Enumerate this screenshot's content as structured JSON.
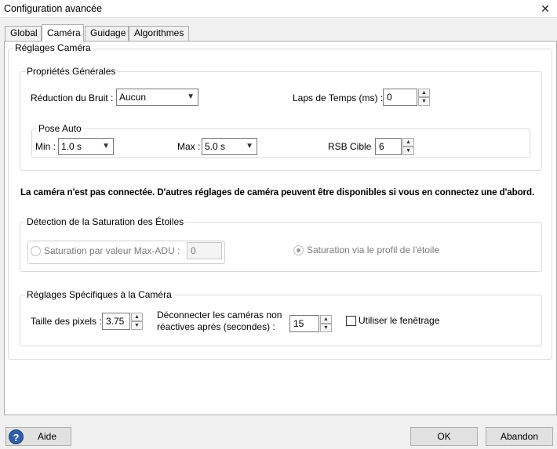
{
  "window": {
    "title": "Configuration avancée",
    "close_glyph": "✕"
  },
  "tabs": [
    {
      "label": "Global"
    },
    {
      "label": "Caméra"
    },
    {
      "label": "Guidage"
    },
    {
      "label": "Algorithmes"
    }
  ],
  "camera_settings": {
    "label": "Réglages Caméra",
    "general": {
      "label": "Propriétés Générales",
      "noise_reduction": {
        "label": "Réduction du Bruit :",
        "value": "Aucun"
      },
      "time_lapse": {
        "label": "Laps de Temps (ms) :",
        "value": "0"
      },
      "auto_exposure": {
        "label": "Pose Auto",
        "min": {
          "label": "Min :",
          "value": "1.0 s"
        },
        "max": {
          "label": "Max :",
          "value": "5.0 s"
        },
        "snr": {
          "label": "RSB Cible :",
          "value": "6"
        }
      }
    },
    "not_connected_note": "La caméra n'est pas connectée. D'autres réglages de caméra peuvent être disponibles si vous en connectez une d'abord.",
    "saturation": {
      "label": "Détection de la Saturation des Étoiles",
      "by_adu": {
        "label": "Saturation par valeur Max-ADU :",
        "value": "0",
        "selected": false
      },
      "by_profile": {
        "label": "Saturation via le profil de l'étoile",
        "selected": true
      }
    },
    "specific": {
      "label": "Réglages Spécifiques à la Caméra",
      "pixel_size": {
        "label": "Taille des pixels :",
        "value": "3.75"
      },
      "disconnect": {
        "label_line1": "Déconnecter les caméras non",
        "label_line2": "réactives après (secondes) :",
        "value": "15"
      },
      "windowing": {
        "label": "Utiliser le fenêtrage",
        "checked": false
      }
    }
  },
  "footer": {
    "help_label": "Aide",
    "help_icon": "?",
    "ok_label": "OK",
    "cancel_label": "Abandon"
  },
  "glyphs": {
    "chevron": "▼",
    "up": "▲",
    "down": "▼"
  }
}
